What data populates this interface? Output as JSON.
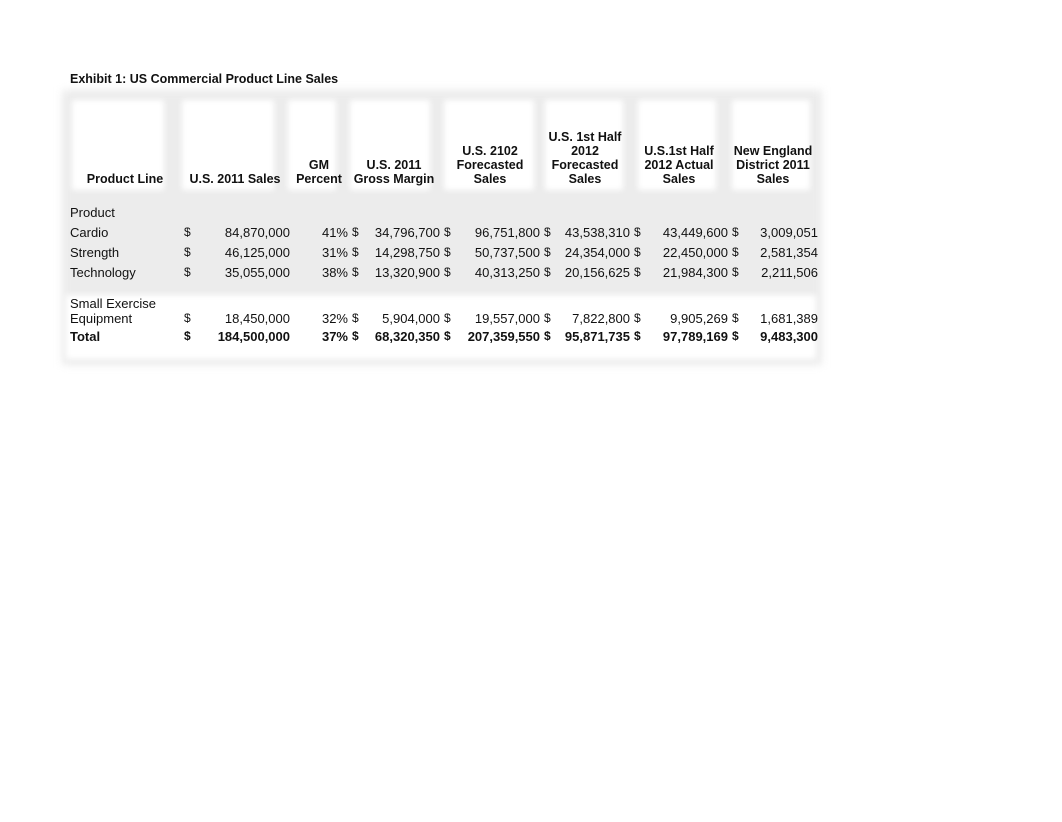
{
  "title": "Exhibit 1:  US Commercial Product Line Sales",
  "headers": {
    "product_line": "Product Line",
    "us_2011_sales": "U.S. 2011 Sales",
    "gm_percent_1": "GM",
    "gm_percent_2": "Percent",
    "gross_margin_1": "U.S. 2011",
    "gross_margin_2": "Gross Margin",
    "forecast_2102_1": "U.S. 2102",
    "forecast_2102_2": "Forecasted",
    "forecast_2102_3": "Sales",
    "h1_forecast_1": "U.S. 1st Half",
    "h1_forecast_2": "2012",
    "h1_forecast_3": "Forecasted",
    "h1_forecast_4": "Sales",
    "h1_actual_1": "U.S.1st Half",
    "h1_actual_2": "2012 Actual",
    "h1_actual_3": "Sales",
    "ne_1": "New England",
    "ne_2": "District 2011",
    "ne_3": "Sales"
  },
  "currency": "$",
  "section_label": "Product",
  "rows": [
    {
      "name": "Cardio",
      "sales_2011": "84,870,000",
      "gm_pct": "41%",
      "gross_margin": "34,796,700",
      "forecast_2102": "96,751,800",
      "h1_forecast": "43,538,310",
      "h1_actual": "43,449,600",
      "ne_2011": "3,009,051"
    },
    {
      "name": "Strength",
      "sales_2011": "46,125,000",
      "gm_pct": "31%",
      "gross_margin": "14,298,750",
      "forecast_2102": "50,737,500",
      "h1_forecast": "24,354,000",
      "h1_actual": "22,450,000",
      "ne_2011": "2,581,354"
    },
    {
      "name": "Technology",
      "sales_2011": "35,055,000",
      "gm_pct": "38%",
      "gross_margin": "13,320,900",
      "forecast_2102": "40,313,250",
      "h1_forecast": "20,156,625",
      "h1_actual": "21,984,300",
      "ne_2011": "2,211,506"
    },
    {
      "name_1": "Small Exercise",
      "name_2": "Equipment",
      "sales_2011": "18,450,000",
      "gm_pct": "32%",
      "gross_margin": "5,904,000",
      "forecast_2102": "19,557,000",
      "h1_forecast": "7,822,800",
      "h1_actual": "9,905,269",
      "ne_2011": "1,681,389"
    }
  ],
  "total": {
    "name": "Total",
    "sales_2011": "184,500,000",
    "gm_pct": "37%",
    "gross_margin": "68,320,350",
    "forecast_2102": "207,359,550",
    "h1_forecast": "95,871,735",
    "h1_actual": "97,789,169",
    "ne_2011": "9,483,300"
  }
}
